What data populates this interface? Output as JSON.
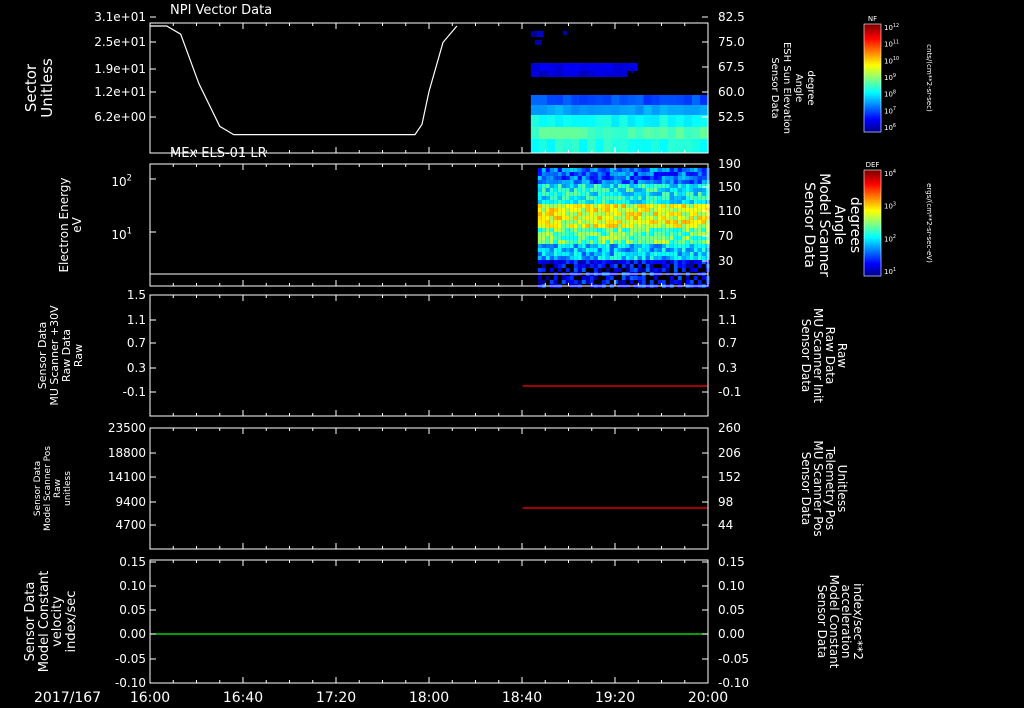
{
  "colors": {
    "background": "#000000",
    "axes": "#ffffff",
    "red_trace": "#ff0000",
    "green_trace": "#00ff00",
    "sector_trace": "#ffffff"
  },
  "time_axis": {
    "date_label": "2017/167",
    "ticks": [
      "16:00",
      "16:40",
      "17:20",
      "18:00",
      "18:40",
      "19:20",
      "20:00"
    ]
  },
  "colorbars": [
    {
      "badge": "NF",
      "unit_label": "cnts/(cm**2-sr-sec)",
      "tick_labels": [
        "10^12",
        "10^11",
        "10^10",
        "10^9",
        "10^8",
        "10^7",
        "10^6"
      ]
    },
    {
      "badge": "DEF",
      "unit_label": "ergs/(cm**2-sr-sec-eV)",
      "tick_labels": [
        "10^4",
        "10^3",
        "10^2",
        "10^1"
      ]
    }
  ],
  "chart_data": [
    {
      "type": "line",
      "panel_title": "NPI Vector Data",
      "left_axis": {
        "label_lines": [
          "Sector",
          "Unitless"
        ],
        "tick_labels": [
          "3.1e+01",
          "2.5e+01",
          "1.9e+01",
          "1.2e+01",
          "6.2e+00"
        ]
      },
      "right_axis": {
        "label_lines": [
          "Sensor Data",
          "ESH Sun Elevation",
          "Angle",
          "degree"
        ],
        "tick_labels": [
          "82.5",
          "75.0",
          "67.5",
          "60.0",
          "52.5"
        ]
      },
      "series": [
        {
          "x_hours": [
            16.0,
            16.12,
            16.22,
            16.35,
            16.5,
            16.6,
            17.0,
            17.5,
            17.9,
            17.95,
            18.0,
            18.1,
            18.2
          ],
          "y": [
            31,
            31,
            29,
            17,
            6.5,
            4.5,
            4.5,
            4.5,
            4.5,
            7,
            15,
            27,
            31
          ]
        }
      ],
      "heatmap_start_hour": 18.73,
      "heatmap_end_hour": 20.0
    },
    {
      "type": "heatmap",
      "panel_title": "MEx ELS-01 LR",
      "left_axis": {
        "label_lines": [
          "Electron Energy",
          "eV"
        ],
        "tick_labels": [
          "10^2",
          "10^1"
        ]
      },
      "right_axis": {
        "label_lines": [
          "Sensor Data",
          "Model Scanner",
          "Angle",
          "degrees"
        ],
        "tick_labels": [
          "190",
          "150",
          "110",
          "70",
          "30"
        ]
      },
      "data_start_hour": 18.78,
      "data_end_hour": 20.0
    },
    {
      "type": "line",
      "left_axis": {
        "label_lines": [
          "Sensor Data",
          "MU Scanner +30V",
          "Raw Data",
          "Raw"
        ],
        "tick_labels": [
          "1.5",
          "1.1",
          "0.7",
          "0.3",
          "-0.1"
        ]
      },
      "right_axis": {
        "label_lines": [
          "Sensor Data",
          "MU Scanner Init",
          "Raw Data",
          "Raw"
        ],
        "tick_labels": [
          "1.5",
          "1.1",
          "0.7",
          "0.3",
          "-0.1"
        ]
      },
      "series": [
        {
          "x_hours": [
            18.67,
            20.0
          ],
          "y": [
            0,
            0
          ]
        }
      ]
    },
    {
      "type": "line",
      "left_axis": {
        "label_lines": [
          "Sensor Data",
          "Model Scanner Pos",
          "Raw",
          "unitless"
        ],
        "tick_labels": [
          "23500",
          "18800",
          "14100",
          "9400",
          "4700"
        ]
      },
      "right_axis": {
        "label_lines": [
          "Sensor Data",
          "MU Scanner Pos",
          "Telemetry Pos",
          "Unitless"
        ],
        "tick_labels": [
          "260",
          "206",
          "152",
          "98",
          "44"
        ]
      },
      "series": [
        {
          "x_hours": [
            18.67,
            20.0
          ],
          "y": [
            8200,
            8200
          ]
        }
      ]
    },
    {
      "type": "line",
      "left_axis": {
        "label_lines": [
          "Sensor Data",
          "Model Constant",
          "velocity",
          "index/sec"
        ],
        "tick_labels": [
          "0.15",
          "0.10",
          "0.05",
          "0.00",
          "-0.05",
          "-0.10"
        ]
      },
      "right_axis": {
        "label_lines": [
          "Sensor Data",
          "Model Constant",
          "acceleration",
          "index/sec**2"
        ],
        "tick_labels": [
          "0.15",
          "0.10",
          "0.05",
          "0.00",
          "-0.05",
          "-0.10"
        ]
      },
      "series": [
        {
          "x_hours": [
            16.0,
            20.0
          ],
          "y": [
            0,
            0
          ]
        }
      ]
    }
  ]
}
